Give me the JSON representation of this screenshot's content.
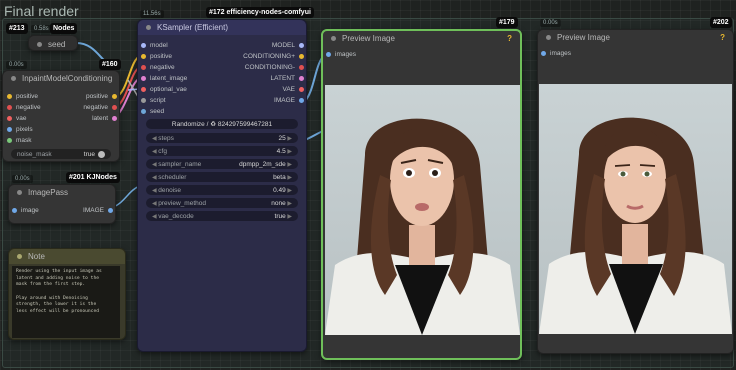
{
  "group": {
    "title": "Final render"
  },
  "seed_node": {
    "badge": "#213",
    "badge2": "Nodes",
    "time": "0.58s",
    "title": "seed"
  },
  "inpaint_node": {
    "badge": "#160",
    "time": "0.00s",
    "title": "InpaintModelConditioning",
    "inputs": [
      "positive",
      "negative",
      "vae",
      "pixels",
      "mask"
    ],
    "outputs": [
      "positive",
      "negative",
      "latent"
    ],
    "toggle_label": "noise_mask",
    "toggle_value": "true"
  },
  "imagepass_node": {
    "badge": "#201 KJNodes",
    "time": "0.00s",
    "title": "ImagePass",
    "input": "image",
    "output": "IMAGE"
  },
  "note_node": {
    "title": "Note",
    "text": "Render using the input image as\nlatent and adding noise to the\nmask from the first step.\n\nPlay around with Denoising\nstrength, the lower it is the\nless effect will be pronounced"
  },
  "ksampler_node": {
    "badge": "#172 efficiency-nodes-comfyui",
    "time": "11.56s",
    "title": "KSampler (Efficient)",
    "inputs": [
      "model",
      "positive",
      "negative",
      "latent_image",
      "optional_vae",
      "script"
    ],
    "outputs": [
      "MODEL",
      "CONDITIONING+",
      "CONDITIONING-",
      "LATENT",
      "VAE",
      "IMAGE"
    ],
    "seed_label": "seed",
    "randomize_label": "Randomize / ♻ 824297599467281",
    "widgets": [
      {
        "label": "steps",
        "value": "25"
      },
      {
        "label": "cfg",
        "value": "4.5"
      },
      {
        "label": "sampler_name",
        "value": "dpmpp_2m_sde"
      },
      {
        "label": "scheduler",
        "value": "beta"
      },
      {
        "label": "denoise",
        "value": "0.49"
      },
      {
        "label": "preview_method",
        "value": "none"
      },
      {
        "label": "vae_decode",
        "value": "true"
      }
    ]
  },
  "preview1": {
    "badge": "#179",
    "title": "Preview Image",
    "input": "images",
    "help": "?"
  },
  "preview2": {
    "badge": "#202",
    "time": "0.00s",
    "title": "Preview Image",
    "input": "images",
    "help": "?"
  },
  "colors": {
    "pin_positive": "#e8b830",
    "pin_negative": "#e05050",
    "pin_vae": "#f06060",
    "pin_image": "#70a8e8",
    "pin_latent": "#e080d0",
    "pin_model": "#a8b8f8",
    "selected_border": "#6fbf5a"
  }
}
